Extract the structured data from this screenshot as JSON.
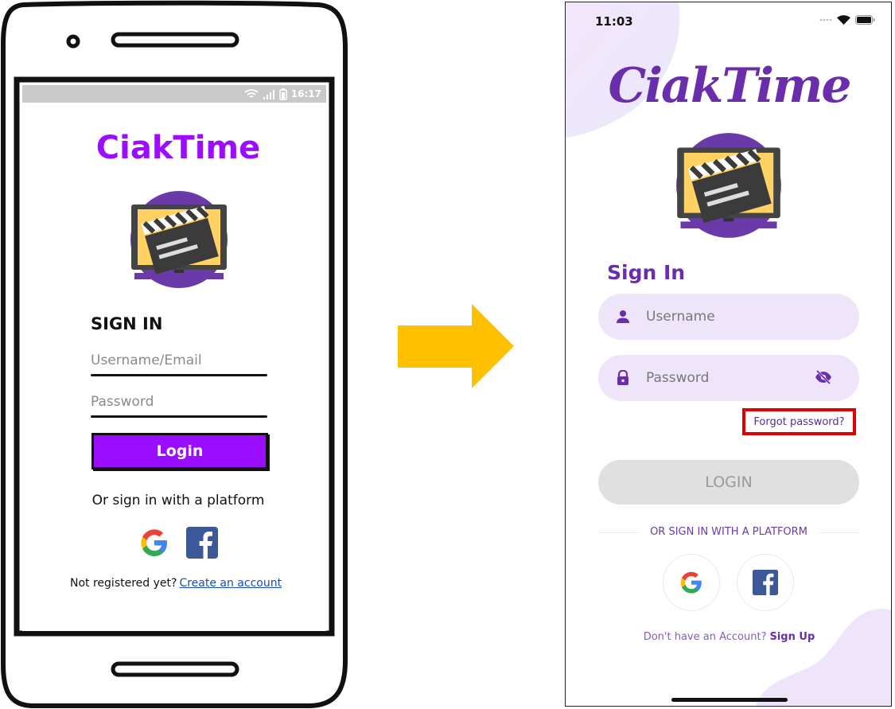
{
  "wireframe": {
    "status_time": "16:17",
    "app_title": "CiakTime",
    "sign_in_heading": "SIGN IN",
    "username_placeholder": "Username/Email",
    "password_placeholder": "Password",
    "login_label": "Login",
    "or_text": "Or sign in with a platform",
    "footer_text": "Not registered yet?",
    "footer_link": "Create an account",
    "accent_color": "#9b0dff"
  },
  "arrow": {
    "color": "#ffc000",
    "icon": "arrow-right-icon"
  },
  "mockup": {
    "status_time": "11:03",
    "app_title": "CiakTime",
    "sign_in_heading": "Sign In",
    "username_placeholder": "Username",
    "password_placeholder": "Password",
    "forgot_label": "Forgot password?",
    "login_label": "LOGIN",
    "divider_text": "OR SIGN IN WITH A PLATFORM",
    "footer_text": "Don't have an Account?",
    "footer_link": "Sign Up",
    "accent_color": "#6a2dab",
    "field_bg": "#efe5fb",
    "highlight_color": "#e00000"
  }
}
